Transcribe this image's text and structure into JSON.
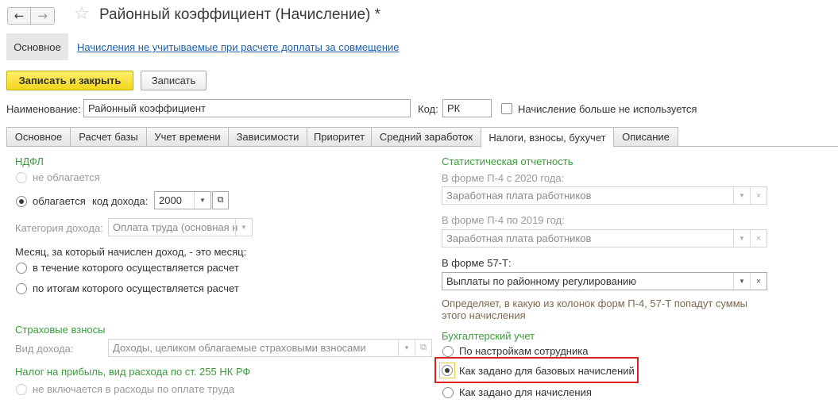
{
  "window": {
    "title": "Районный коэффициент (Начисление) *",
    "back_icon": "←",
    "forward_icon": "→",
    "favorite_icon": "☆"
  },
  "sections": {
    "main_label": "Основное",
    "link_label": "Начисления не учитываемые при расчете доплаты за совмещение"
  },
  "commands": {
    "save_close_label": "Записать и закрыть",
    "save_label": "Записать"
  },
  "header_fields": {
    "name_label": "Наименование:",
    "name_value": "Районный коэффициент",
    "code_label": "Код:",
    "code_value": "РК",
    "unused_label": "Начисление больше не используется"
  },
  "tabs": [
    {
      "label": "Основное"
    },
    {
      "label": "Расчет базы"
    },
    {
      "label": "Учет времени"
    },
    {
      "label": "Зависимости"
    },
    {
      "label": "Приоритет"
    },
    {
      "label": "Средний заработок"
    },
    {
      "label": "Налоги, взносы, бухучет"
    },
    {
      "label": "Описание"
    }
  ],
  "ndfl": {
    "heading": "НДФЛ",
    "not_taxed_label": "не облагается",
    "taxed_label": "облагается",
    "income_code_label": "код дохода:",
    "income_code_value": "2000",
    "category_label": "Категория дохода:",
    "category_value": "Оплата труда (основная н",
    "month_label": "Месяц, за который начислен доход, - это месяц:",
    "month_option_1": "в течение которого осуществляется расчет",
    "month_option_2": "по итогам которого осуществляется расчет"
  },
  "insurance": {
    "heading": "Страховые взносы",
    "income_type_label": "Вид дохода:",
    "income_type_value": "Доходы, целиком облагаемые страховыми взносами"
  },
  "profit_tax": {
    "heading": "Налог на прибыль, вид расхода по ст. 255 НК РФ",
    "option_label": "не включается в расходы по оплате труда"
  },
  "statistics": {
    "heading": "Статистическая отчетность",
    "p4_2020_label": "В форме П-4 с 2020 года:",
    "p4_2020_value": "Заработная плата работников",
    "p4_2019_label": "В форме П-4 по 2019 год:",
    "p4_2019_value": "Заработная плата работников",
    "f57t_label": "В форме 57-Т:",
    "f57t_value": "Выплаты по районному регулированию",
    "hint_line_1": "Определяет, в какую из колонок форм П-4, 57-Т попадут суммы",
    "hint_line_2": "этого начисления"
  },
  "accounting": {
    "heading": "Бухгалтерский учет",
    "option_1": "По настройкам сотрудника",
    "option_2": "Как задано для базовых начислений",
    "option_3": "Как задано для начисления"
  },
  "glyphs": {
    "dropdown": "▼",
    "clear": "×",
    "open": "⧉"
  }
}
